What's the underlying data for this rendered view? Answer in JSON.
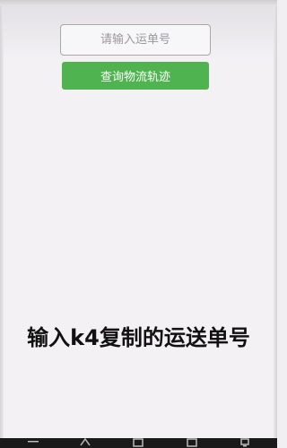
{
  "search": {
    "placeholder": "请输入运单号",
    "value": ""
  },
  "actions": {
    "query_label": "查询物流轨迹"
  },
  "caption": {
    "text": "输入k4复制的运送单号"
  },
  "navbar": {
    "icons": [
      "menu-icon",
      "back-icon",
      "home-icon",
      "recents-icon",
      "notification-icon"
    ]
  },
  "colors": {
    "accent": "#4fb44f",
    "background": "#f2eff3",
    "caption_text": "#111111"
  }
}
